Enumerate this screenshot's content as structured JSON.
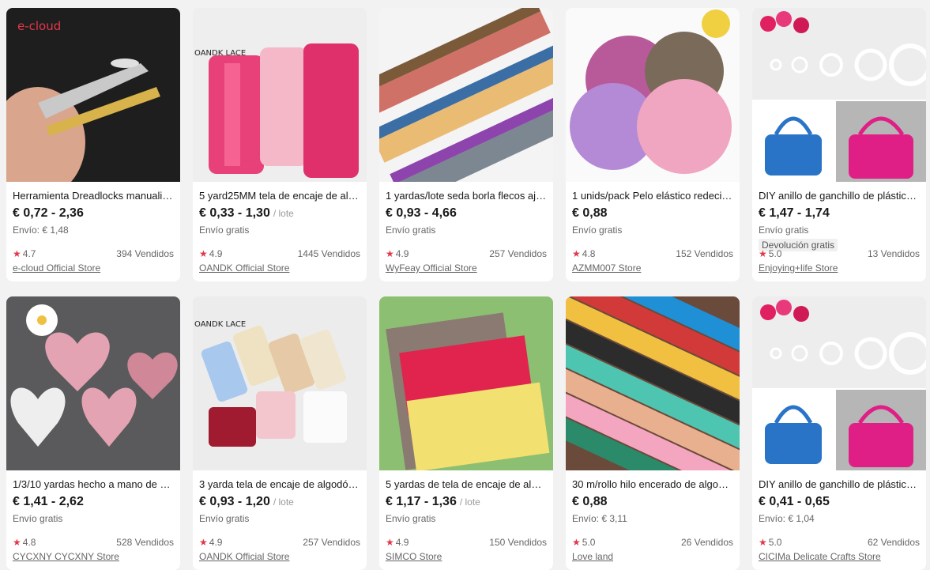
{
  "products": [
    {
      "title": "Herramienta Dreadlocks manualid…",
      "price": "€ 0,72 - 2,36",
      "unit": "",
      "shipping": "Envío: € 1,48",
      "badge": "",
      "rating": "4.7",
      "sold": "394 Vendidos",
      "store": "e-cloud Official Store",
      "logo": "e-cloud"
    },
    {
      "title": "5 yard25MM tela de encaje de algo…",
      "price": "€ 0,33 - 1,30",
      "unit": "/ lote",
      "shipping": "Envío gratis",
      "badge": "",
      "rating": "4.9",
      "sold": "1445 Vendidos",
      "store": "OANDK Official Store",
      "logo": "OANDK LACE"
    },
    {
      "title": "1 yardas/lote seda borla flecos aju…",
      "price": "€ 0,93 - 4,66",
      "unit": "",
      "shipping": "Envío gratis",
      "badge": "",
      "rating": "4.9",
      "sold": "257 Vendidos",
      "store": "WyFeay Official Store",
      "logo": ""
    },
    {
      "title": "1 unids/pack Pelo elástico redecilla…",
      "price": "€ 0,88",
      "unit": "",
      "shipping": "Envío gratis",
      "badge": "",
      "rating": "4.8",
      "sold": "152 Vendidos",
      "store": "AZMM007 Store",
      "logo": ""
    },
    {
      "title": "DIY anillo de ganchillo de plástico, …",
      "price": "€ 1,47 - 1,74",
      "unit": "",
      "shipping": "Envío gratis",
      "badge": "Devolución gratis",
      "rating": "5.0",
      "sold": "13 Vendidos",
      "store": "Enjoying+life Store",
      "logo": ""
    },
    {
      "title": "1/3/10 yardas hecho a mano de en…",
      "price": "€ 1,41 - 2,62",
      "unit": "",
      "shipping": "Envío gratis",
      "badge": "",
      "rating": "4.8",
      "sold": "528 Vendidos",
      "store": "CYCXNY CYCXNY Store",
      "logo": ""
    },
    {
      "title": "3 yarda tela de encaje de algodón …",
      "price": "€ 0,93 - 1,20",
      "unit": "/ lote",
      "shipping": "Envío gratis",
      "badge": "",
      "rating": "4.9",
      "sold": "257 Vendidos",
      "store": "OANDK Official Store",
      "logo": "OANDK LACE"
    },
    {
      "title": "5 yardas de tela de encaje de algo…",
      "price": "€ 1,17 - 1,36",
      "unit": "/ lote",
      "shipping": "Envío gratis",
      "badge": "",
      "rating": "4.9",
      "sold": "150 Vendidos",
      "store": "SIMCO Store",
      "logo": ""
    },
    {
      "title": "30 m/rollo hilo encerado de algod…",
      "price": "€ 0,88",
      "unit": "",
      "shipping": "Envío: € 3,11",
      "badge": "",
      "rating": "5.0",
      "sold": "26 Vendidos",
      "store": "Love land",
      "logo": ""
    },
    {
      "title": "DIY anillo de ganchillo de plástico, …",
      "price": "€ 0,41 - 0,65",
      "unit": "",
      "shipping": "Envío: € 1,04",
      "badge": "",
      "rating": "5.0",
      "sold": "62 Vendidos",
      "store": "CICIMa Delicate Crafts Store",
      "logo": ""
    }
  ],
  "colors": {
    "star": "#e2374a",
    "page_bg": "#f2f2f2",
    "card_bg": "#ffffff"
  }
}
